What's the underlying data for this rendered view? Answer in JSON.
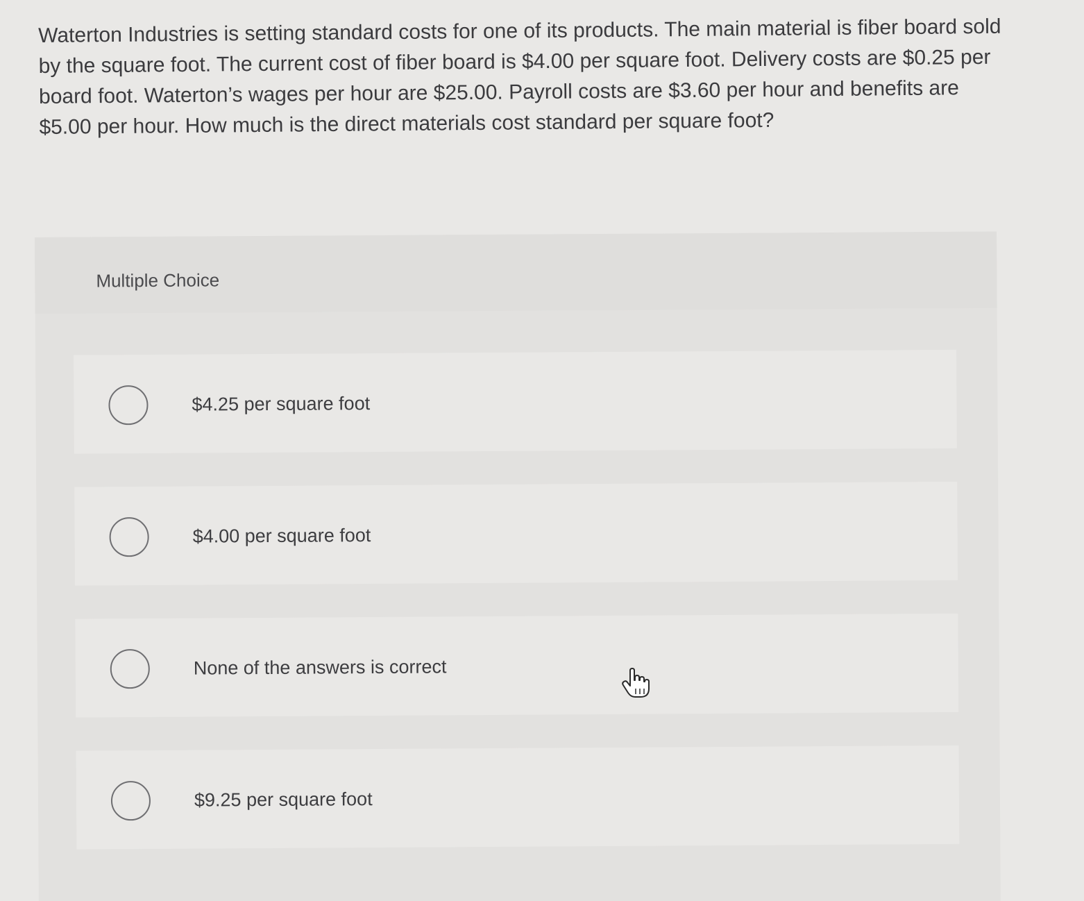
{
  "question": {
    "text": "Waterton Industries is setting standard costs for one of its products. The main material is fiber board sold by the square foot. The current cost of fiber board is $4.00 per square foot. Delivery costs are $0.25 per board foot. Waterton’s wages per hour are $25.00. Payroll costs are $3.60 per hour and benefits are $5.00 per hour. How much is the direct materials cost standard per square foot?"
  },
  "multiple_choice": {
    "header": "Multiple Choice",
    "options": [
      {
        "label": "$4.25 per square foot"
      },
      {
        "label": "$4.00 per square foot"
      },
      {
        "label": "None of the answers is correct"
      },
      {
        "label": "$9.25 per square foot"
      }
    ]
  },
  "cursor": {
    "icon": "hand-pointer-icon"
  }
}
